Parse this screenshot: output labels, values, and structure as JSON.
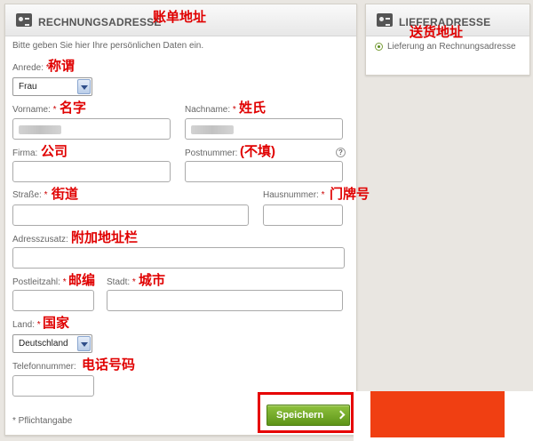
{
  "billing": {
    "title": "RECHNUNGSADRESSE",
    "annotation": "账单地址",
    "intro": "Bitte geben Sie hier Ihre persönlichen Daten ein.",
    "salutation": {
      "label": "Anrede:",
      "req": " *",
      "annotation": "称谓",
      "value": "Frau"
    },
    "firstname": {
      "label": "Vorname:",
      "req": " *",
      "annotation": "名字"
    },
    "lastname": {
      "label": "Nachname:",
      "req": " *",
      "annotation": "姓氏"
    },
    "company": {
      "label": "Firma:",
      "annotation": "公司"
    },
    "postnumber": {
      "label": "Postnummer:",
      "annotation": "(不填)",
      "help": "?"
    },
    "street": {
      "label": "Straße:",
      "req": " *",
      "annotation": "街道"
    },
    "housenumber": {
      "label": "Hausnummer:",
      "req": " *",
      "annotation": "门牌号"
    },
    "addition": {
      "label": "Adresszusatz:",
      "annotation": "附加地址栏"
    },
    "zip": {
      "label": "Postleitzahl:",
      "req": " *",
      "annotation": "邮编"
    },
    "city": {
      "label": "Stadt:",
      "req": " *",
      "annotation": "城市"
    },
    "country": {
      "label": "Land:",
      "req": " *",
      "annotation": "国家",
      "value": "Deutschland"
    },
    "phone": {
      "label": "Telefonnummer:",
      "annotation": "电话号码"
    },
    "required_note": "* Pflichtangabe",
    "save_label": "Speichern"
  },
  "shipping": {
    "title": "LIEFERADRESSE",
    "annotation": "送货地址",
    "option_label": "Lieferung an Rechnungsadresse"
  },
  "colors": {
    "accent_green": "#5d9418",
    "annotation_red": "#e00000",
    "highlight_box": "#e60000"
  }
}
